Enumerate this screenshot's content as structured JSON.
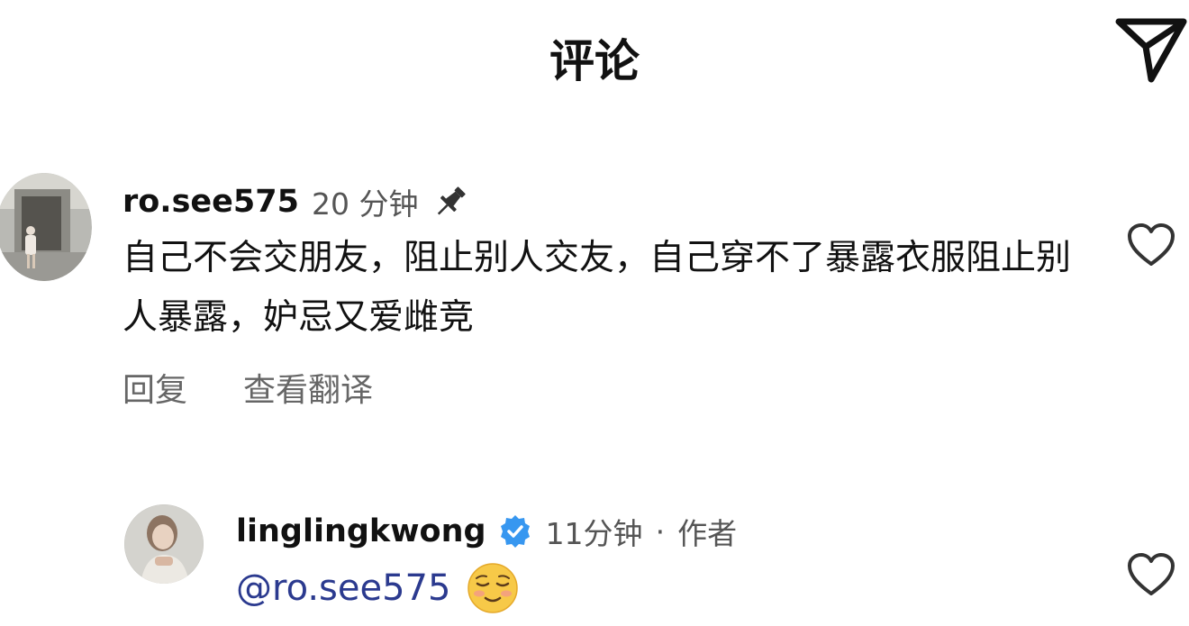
{
  "header": {
    "title": "评论",
    "send_icon": "send-icon"
  },
  "comments": [
    {
      "username": "ro.see575",
      "time": "20 分钟",
      "pinned_icon": "pin-icon",
      "text": "自己不会交朋友，阻止别人交友，自己穿不了暴露衣服阻止别人暴露，妒忌又爱雌竞",
      "actions": [
        "回复",
        "查看翻译"
      ],
      "like_icon": "heart-icon"
    },
    {
      "username": "linglingkwong",
      "verified_icon": "verified-badge-icon",
      "time": "11分钟",
      "separator": "·",
      "author_label": "作者",
      "mention": "@ro.see575",
      "emoji": "relieved-face-emoji",
      "like_icon": "heart-icon"
    }
  ],
  "colors": {
    "background": "#ffffff",
    "text": "#111111",
    "muted": "#555555",
    "mention": "#2b3a8f",
    "verified": "#3797f0"
  }
}
